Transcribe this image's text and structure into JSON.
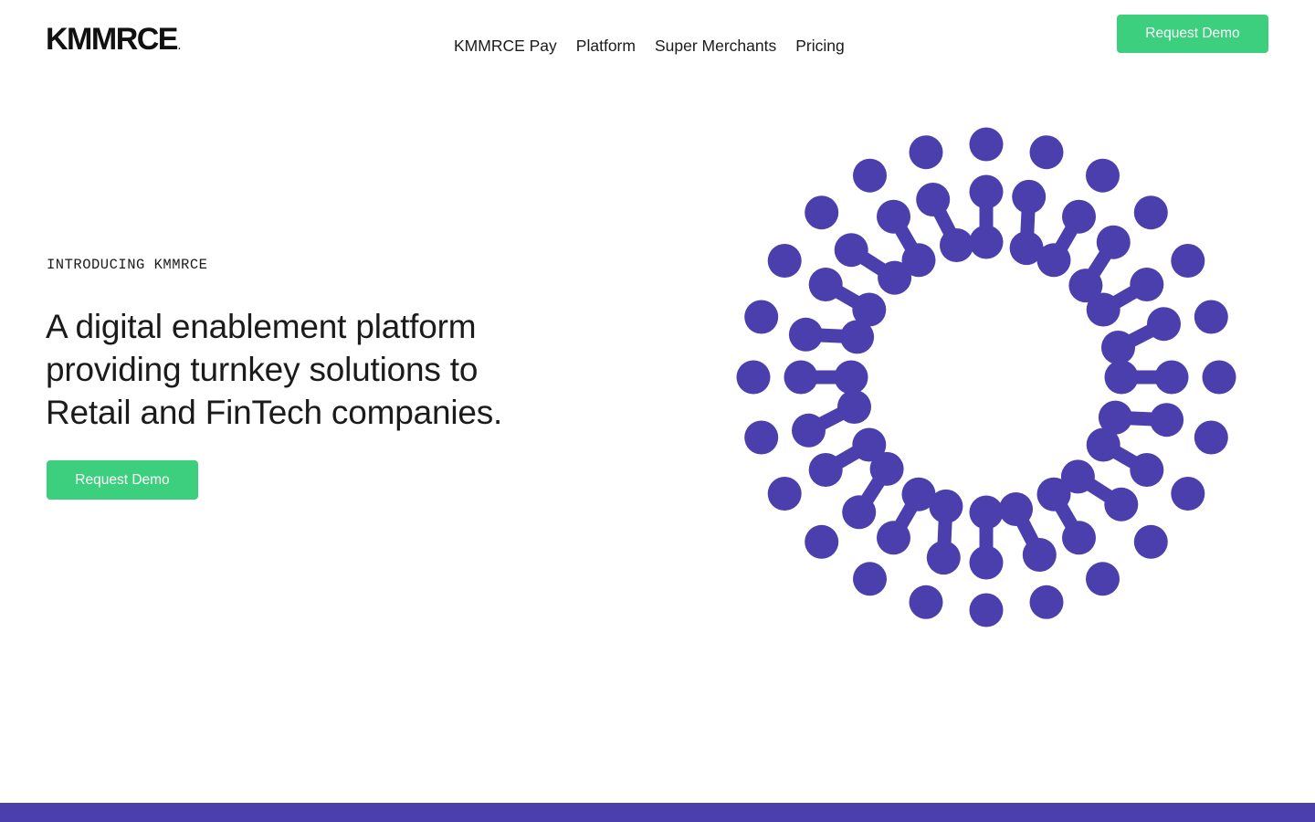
{
  "brand": {
    "name": "KMMRCE",
    "mark": "."
  },
  "nav": {
    "items": [
      {
        "label": "KMMRCE Pay"
      },
      {
        "label": "Platform"
      },
      {
        "label": "Super Merchants"
      },
      {
        "label": "Pricing"
      }
    ]
  },
  "header": {
    "cta_label": "Request Demo"
  },
  "hero": {
    "eyebrow": "INTRODUCING KMMRCE",
    "headline_lines": [
      "A digital enablement platform",
      "providing turnkey solutions to",
      "Retail and FinTech companies."
    ],
    "cta_label": "Request Demo"
  },
  "graphic": {
    "icon": "dotted-radial-burst-icon",
    "color": "#4b3fae"
  },
  "colors": {
    "accent": "#3ccf7d",
    "brand": "#4b3fae",
    "text": "#1b1b1b"
  }
}
